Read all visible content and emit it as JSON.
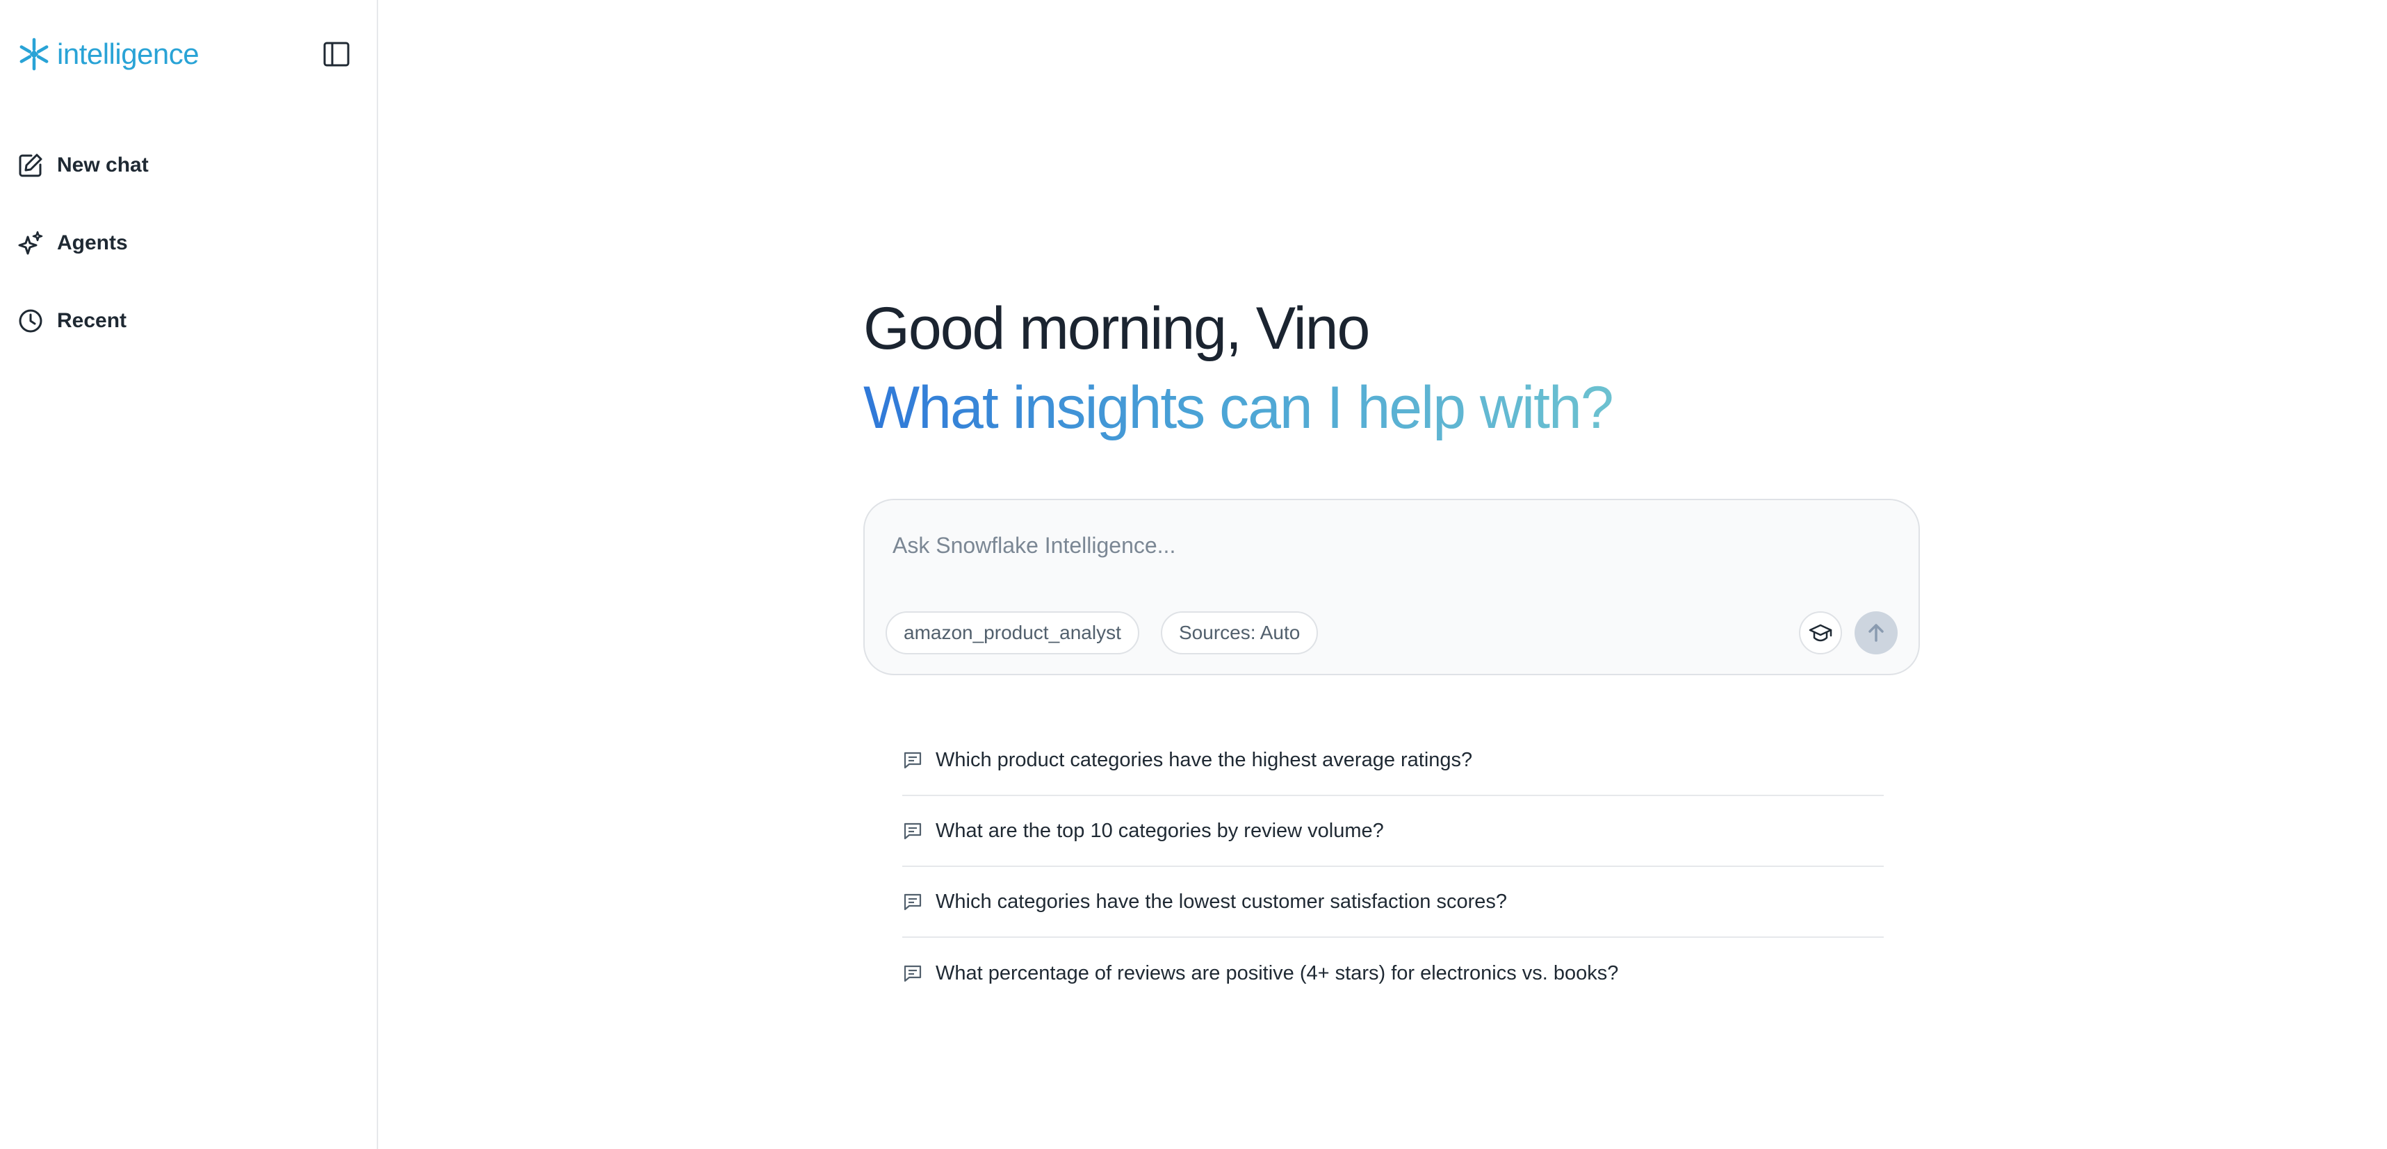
{
  "brand": {
    "name": "intelligence",
    "color": "#29a3d6"
  },
  "sidebar": {
    "items": [
      {
        "label": "New chat",
        "icon": "edit-icon"
      },
      {
        "label": "Agents",
        "icon": "sparkle-icon"
      },
      {
        "label": "Recent",
        "icon": "clock-icon"
      }
    ]
  },
  "main": {
    "greeting": "Good morning, Vino",
    "subgreeting": "What insights can I help with?",
    "composer": {
      "placeholder": "Ask Snowflake Intelligence...",
      "value": "",
      "agent_chip": "amazon_product_analyst",
      "sources_chip": "Sources: Auto"
    },
    "suggestions": [
      "Which product categories have the highest average ratings?",
      "What are the top 10 categories by review volume?",
      "Which categories have the lowest customer satisfaction scores?",
      "What percentage of reviews are positive (4+ stars) for electronics vs. books?"
    ]
  },
  "colors": {
    "gradient_start": "#2f78d8",
    "gradient_end": "#6cc1d0",
    "send_button": "#cdd5df"
  }
}
